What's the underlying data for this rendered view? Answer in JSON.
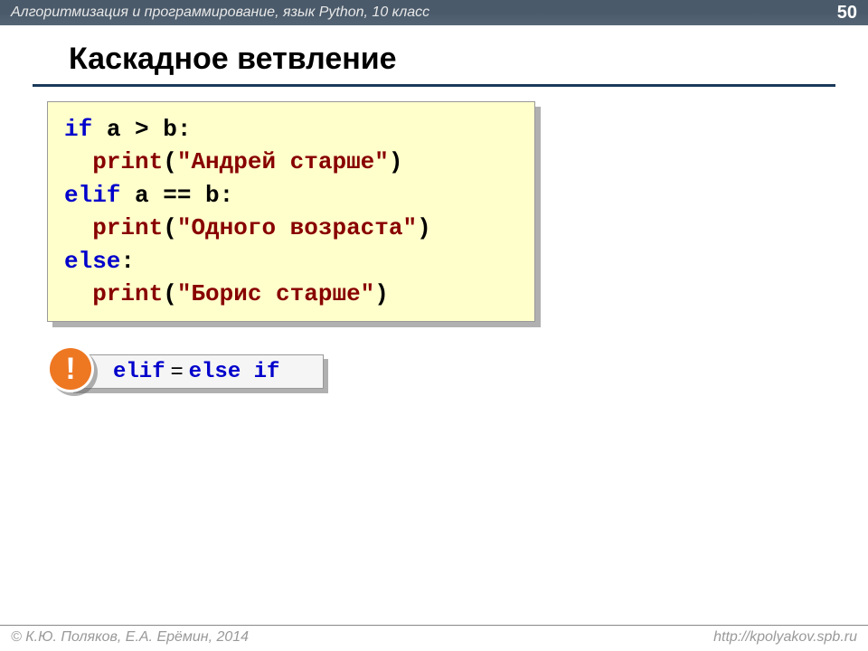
{
  "header": {
    "title": "Алгоритмизация и программирование, язык Python, 10 класс",
    "page": "50"
  },
  "slide": {
    "title": "Каскадное ветвление"
  },
  "code": {
    "l1_kw": "if",
    "l1_rest": " a > b:",
    "l2_fn": "print",
    "l2_paren_open": "(",
    "l2_str": "\"Андрей старше\"",
    "l2_paren_close": ")",
    "l3_kw": "elif",
    "l3_rest": " a == b:",
    "l4_fn": "print",
    "l4_paren_open": "(",
    "l4_str": "\"Одного возраста\"",
    "l4_paren_close": ")",
    "l5_kw": "else",
    "l5_rest": ":",
    "l6_fn": "print",
    "l6_paren_open": "(",
    "l6_str": "\"Борис старше\"",
    "l6_paren_close": ")"
  },
  "note": {
    "badge": "!",
    "elif": "elif",
    "eq": "=",
    "else": "else",
    "if": "if"
  },
  "footer": {
    "copyright": "© К.Ю. Поляков, Е.А. Ерёмин, 2014",
    "url": "http://kpolyakov.spb.ru"
  }
}
